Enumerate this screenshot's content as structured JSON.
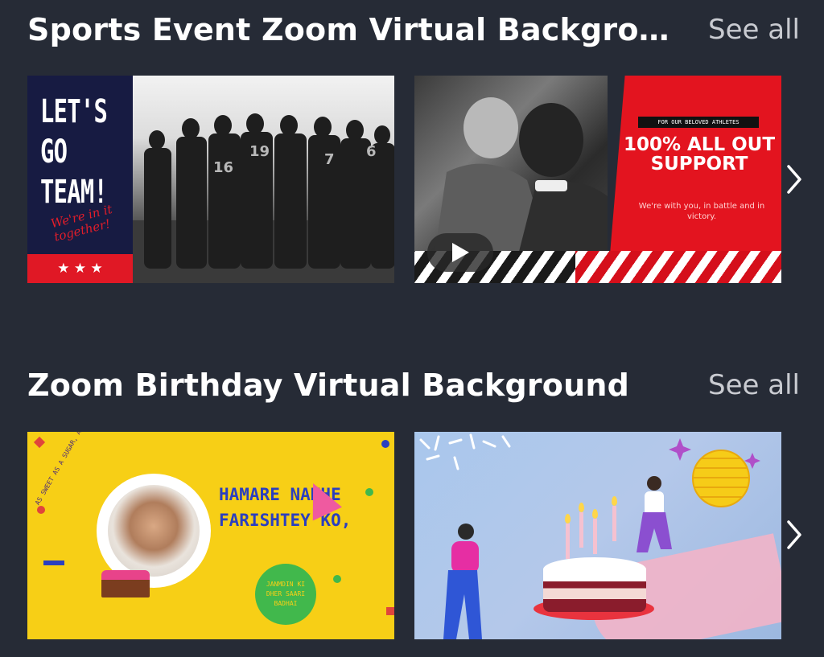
{
  "sections": [
    {
      "title": "Sports Event Zoom Virtual Backgrou...",
      "see_all": "See all",
      "cards": [
        {
          "title_lines": "LET'S GO TEAM!",
          "script_text": "We're in it together!",
          "stars": "★ ★ ★"
        },
        {
          "tag": "FOR OUR BELOVED ATHLETES",
          "headline": "100% ALL OUT SUPPORT",
          "subline": "We're with you, in battle and in victory."
        }
      ]
    },
    {
      "title": "Zoom Birthday Virtual Background",
      "see_all": "See all",
      "cards": [
        {
          "curve_text": "AS SWEET AS A SUGAR, AND AS COOL AS ICE,",
          "main_text": "HAMARE NANHE FARISHTEY KO,",
          "badge_text": "JANMDIN KI DHER SAARI BADHAI"
        },
        {}
      ]
    }
  ],
  "icons": {
    "next": "chevron-right-icon",
    "play": "play-icon",
    "star": "star-icon"
  },
  "colors": {
    "background": "#262b36",
    "see_all": "#c9cbd1",
    "sports_red": "#e3141f",
    "birthday_yellow": "#f7cf16"
  }
}
